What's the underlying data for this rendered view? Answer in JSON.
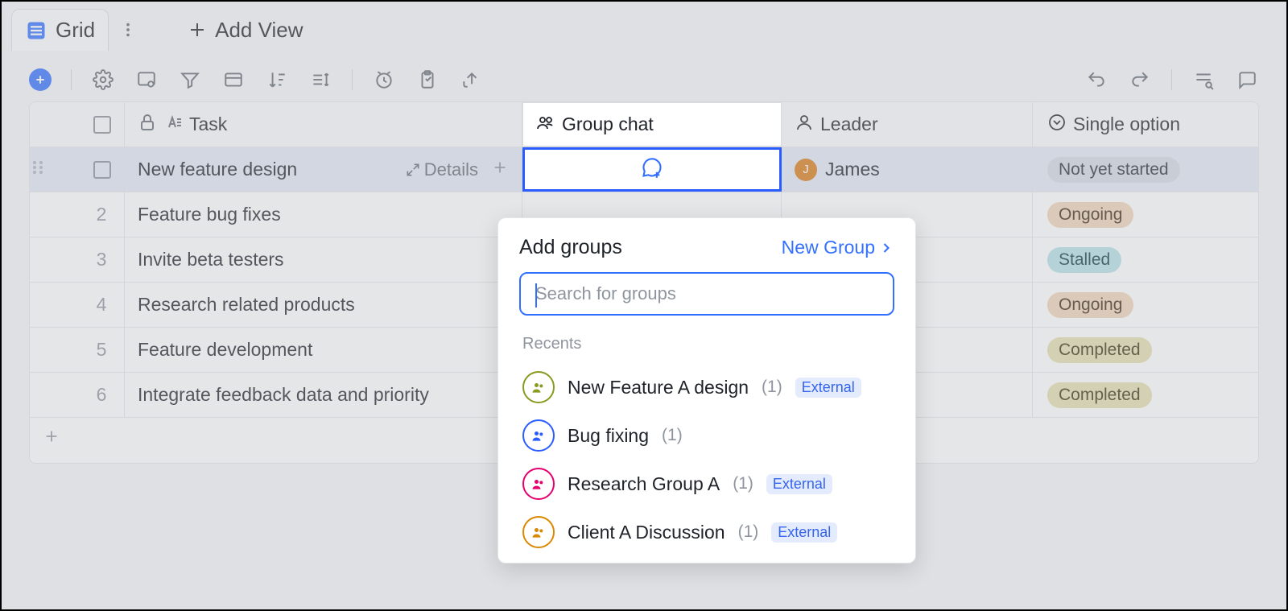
{
  "tabs": {
    "active": "Grid",
    "addView": "Add View"
  },
  "chart_data": {
    "type": "table",
    "columns": [
      "Task",
      "Group chat",
      "Leader",
      "Single option"
    ],
    "rows": [
      [
        "New feature design",
        "",
        "James",
        "Not yet started"
      ],
      [
        "Feature bug fixes",
        "",
        "",
        "Ongoing"
      ],
      [
        "Invite beta testers",
        "",
        "",
        "Stalled"
      ],
      [
        "Research related products",
        "",
        "",
        "Ongoing"
      ],
      [
        "Feature development",
        "",
        "",
        "Completed"
      ],
      [
        "Integrate feedback data and priority",
        "",
        "",
        "Completed"
      ]
    ]
  },
  "columns": {
    "task": "Task",
    "chat": "Group chat",
    "leader": "Leader",
    "status": "Single option"
  },
  "rows": [
    {
      "num": "",
      "task": "New feature design",
      "details": "Details",
      "leader": "James",
      "leaderInitial": "J",
      "status": "Not yet started",
      "statusClass": "p-notstarted",
      "active": true
    },
    {
      "num": "2",
      "task": "Feature bug fixes",
      "status": "Ongoing",
      "statusClass": "p-ongoing"
    },
    {
      "num": "3",
      "task": "Invite beta testers",
      "status": "Stalled",
      "statusClass": "p-stalled"
    },
    {
      "num": "4",
      "task": "Research related products",
      "status": "Ongoing",
      "statusClass": "p-ongoing"
    },
    {
      "num": "5",
      "task": "Feature development",
      "status": "Completed",
      "statusClass": "p-completed"
    },
    {
      "num": "6",
      "task": "Integrate feedback data and priority",
      "status": "Completed",
      "statusClass": "p-completed"
    }
  ],
  "popover": {
    "title": "Add groups",
    "newGroup": "New Group",
    "searchPlaceholder": "Search for groups",
    "recentsLabel": "Recents",
    "externalLabel": "External",
    "groups": [
      {
        "name": "New Feature A design",
        "count": "(1)",
        "external": true,
        "color": "g-olive"
      },
      {
        "name": "Bug fixing",
        "count": "(1)",
        "external": false,
        "color": "g-blue"
      },
      {
        "name": "Research Group A",
        "count": "(1)",
        "external": true,
        "color": "g-pink"
      },
      {
        "name": "Client A Discussion",
        "count": "(1)",
        "external": true,
        "color": "g-amber"
      }
    ]
  }
}
